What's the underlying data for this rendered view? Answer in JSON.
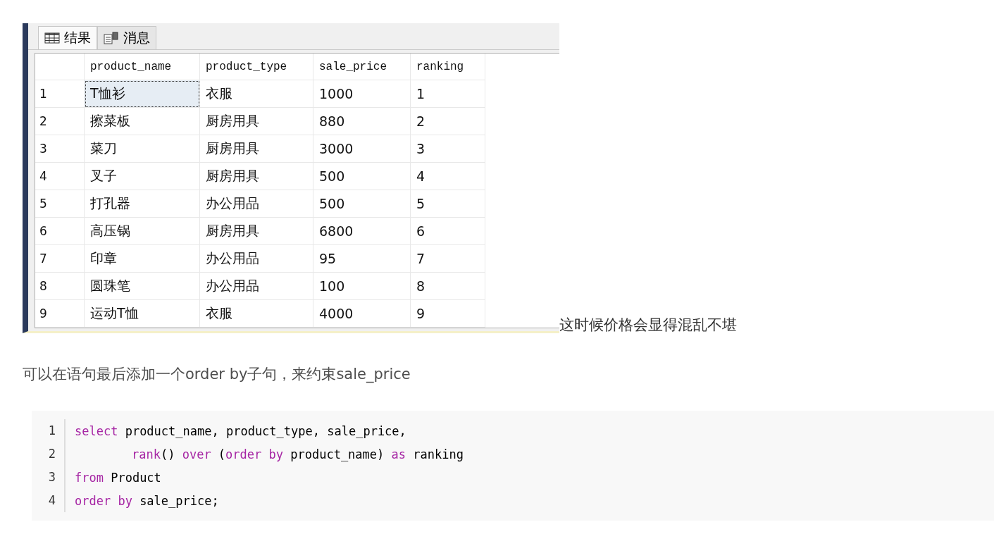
{
  "results_screenshot": {
    "tabs": [
      {
        "label": "结果",
        "selected": true,
        "kind": "grid"
      },
      {
        "label": "消息",
        "selected": false,
        "kind": "messages"
      }
    ],
    "columns": [
      "product_name",
      "product_type",
      "sale_price",
      "ranking"
    ],
    "rows": [
      {
        "number": "1",
        "cells": [
          {
            "text": "T恤衫",
            "selected": true
          },
          {
            "text": "衣服",
            "selected": false
          },
          {
            "text": "1000",
            "selected": false
          },
          {
            "text": "1",
            "selected": false
          }
        ]
      },
      {
        "number": "2",
        "cells": [
          {
            "text": "擦菜板",
            "selected": false
          },
          {
            "text": "厨房用具",
            "selected": false
          },
          {
            "text": "880",
            "selected": false
          },
          {
            "text": "2",
            "selected": false
          }
        ]
      },
      {
        "number": "3",
        "cells": [
          {
            "text": "菜刀",
            "selected": false
          },
          {
            "text": "厨房用具",
            "selected": false
          },
          {
            "text": "3000",
            "selected": false
          },
          {
            "text": "3",
            "selected": false
          }
        ]
      },
      {
        "number": "4",
        "cells": [
          {
            "text": "叉子",
            "selected": false
          },
          {
            "text": "厨房用具",
            "selected": false
          },
          {
            "text": "500",
            "selected": false
          },
          {
            "text": "4",
            "selected": false
          }
        ]
      },
      {
        "number": "5",
        "cells": [
          {
            "text": "打孔器",
            "selected": false
          },
          {
            "text": "办公用品",
            "selected": false
          },
          {
            "text": "500",
            "selected": false
          },
          {
            "text": "5",
            "selected": false
          }
        ]
      },
      {
        "number": "6",
        "cells": [
          {
            "text": "高压锅",
            "selected": false
          },
          {
            "text": "厨房用具",
            "selected": false
          },
          {
            "text": "6800",
            "selected": false
          },
          {
            "text": "6",
            "selected": false
          }
        ]
      },
      {
        "number": "7",
        "cells": [
          {
            "text": "印章",
            "selected": false
          },
          {
            "text": "办公用品",
            "selected": false
          },
          {
            "text": "95",
            "selected": false
          },
          {
            "text": "7",
            "selected": false
          }
        ]
      },
      {
        "number": "8",
        "cells": [
          {
            "text": "圆珠笔",
            "selected": false
          },
          {
            "text": "办公用品",
            "selected": false
          },
          {
            "text": "100",
            "selected": false
          },
          {
            "text": "8",
            "selected": false
          }
        ]
      },
      {
        "number": "9",
        "cells": [
          {
            "text": "运动T恤",
            "selected": false
          },
          {
            "text": "衣服",
            "selected": false
          },
          {
            "text": "4000",
            "selected": false
          },
          {
            "text": "9",
            "selected": false
          }
        ]
      }
    ]
  },
  "caption": "这时候价格会显得混乱不堪",
  "paragraph": "可以在语句最后添加一个order by子句，来约束sale_price",
  "code_block": {
    "lines": [
      {
        "number": "1",
        "indent": false,
        "tokens": [
          {
            "kind": "keyword",
            "text": "select"
          },
          {
            "kind": "plain",
            "text": " product_name, product_type, sale_price,"
          }
        ]
      },
      {
        "number": "2",
        "indent": true,
        "tokens": [
          {
            "kind": "keyword",
            "text": "rank"
          },
          {
            "kind": "plain",
            "text": "() "
          },
          {
            "kind": "keyword",
            "text": "over"
          },
          {
            "kind": "plain",
            "text": " ("
          },
          {
            "kind": "keyword",
            "text": "order by"
          },
          {
            "kind": "plain",
            "text": " product_name) "
          },
          {
            "kind": "keyword",
            "text": "as"
          },
          {
            "kind": "plain",
            "text": " ranking"
          }
        ]
      },
      {
        "number": "3",
        "indent": false,
        "tokens": [
          {
            "kind": "keyword",
            "text": "from"
          },
          {
            "kind": "plain",
            "text": " Product"
          }
        ]
      },
      {
        "number": "4",
        "indent": false,
        "tokens": [
          {
            "kind": "keyword",
            "text": "order by"
          },
          {
            "kind": "plain",
            "text": " sale_price;"
          }
        ]
      }
    ]
  }
}
